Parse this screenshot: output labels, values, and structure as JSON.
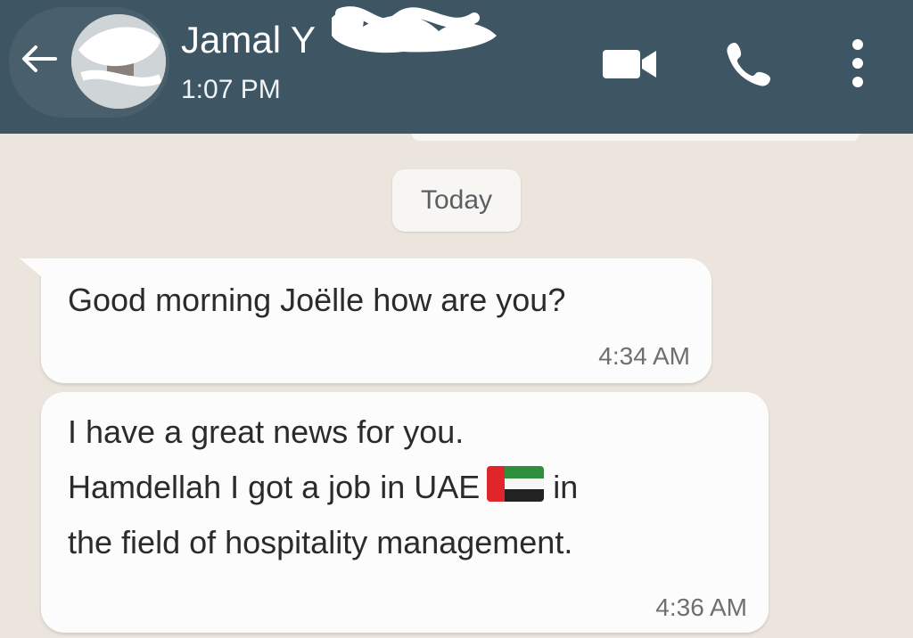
{
  "header": {
    "contact_name": "Jamal Y",
    "last_seen": "1:07 PM",
    "back_icon": "arrow-left-icon",
    "video_icon": "video-camera-icon",
    "call_icon": "phone-icon",
    "menu_icon": "more-vertical-icon",
    "background_color": "#3e5563"
  },
  "chat": {
    "date_separator": "Today",
    "background_color": "#ece5dd",
    "messages": [
      {
        "lines": [
          "Good morning Joëlle how are you?"
        ],
        "time": "4:34 AM"
      },
      {
        "lines": [
          "I have a great news for you.",
          "Hamdellah I got a job in UAE",
          "in",
          "the field of hospitality management."
        ],
        "emoji": "UAE flag",
        "time": "4:36 AM"
      }
    ]
  }
}
